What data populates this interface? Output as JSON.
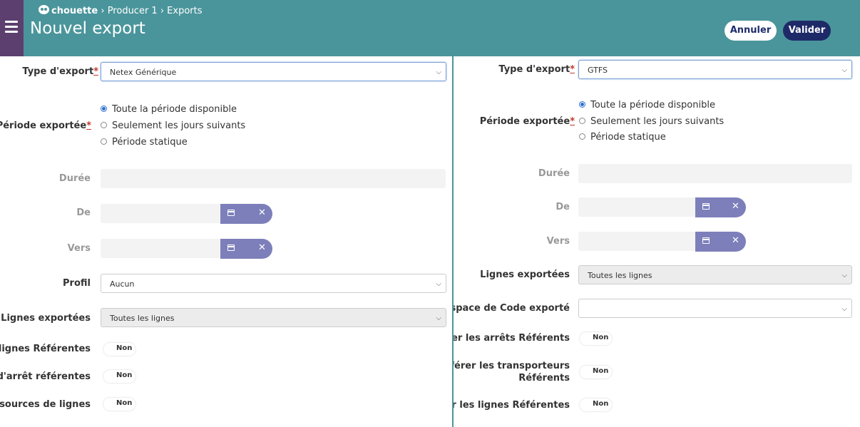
{
  "header": {
    "logo_text": "chouette",
    "breadcrumb_rest": "› Producer 1 › Exports",
    "title": "Nouvel export",
    "cancel_label": "Annuler",
    "submit_label": "Valider"
  },
  "left": {
    "type_label": "Type d'export",
    "type_value": "Netex Générique",
    "period_label": "Période exportée",
    "radio_all": "Toute la période disponible",
    "radio_following": "Seulement les jours suivants",
    "radio_static": "Période statique",
    "duration_label": "Durée",
    "from_label": "De",
    "to_label": "Vers",
    "profile_label": "Profil",
    "profile_value": "Aucun",
    "lines_label": "Lignes exportées",
    "lines_value": "Toutes les lignes",
    "toggle1_label": "es lignes Référentes",
    "toggle2_label": "s d'arrêt référentes",
    "toggle3_label": "essources de lignes",
    "toggle_value": "Non"
  },
  "right": {
    "type_label": "Type d'export",
    "type_value": "GTFS",
    "period_label": "Période exportée",
    "radio_all": "Toute la période disponible",
    "radio_following": "Seulement les jours suivants",
    "radio_static": "Période statique",
    "duration_label": "Durée",
    "from_label": "De",
    "to_label": "Vers",
    "lines_label": "Lignes exportées",
    "lines_value": "Toutes les lignes",
    "codespace_label": "Espace de Code exporté",
    "codespace_value": "",
    "toggle1_label": "férer les arrêts Référents",
    "toggle2_line1": "'référer les transporteurs",
    "toggle2_line2": "Référents",
    "toggle3_label": "érer les lignes Référentes",
    "toggle_value": "Non"
  },
  "required_mark": "*",
  "colors": {
    "header": "#4a959b",
    "menu": "#5c3f6e",
    "primary": "#1e2a68",
    "datepicker": "#7d7fbb"
  },
  "icons": [
    "menu-icon",
    "owl-logo-icon",
    "chevron-down-icon",
    "calendar-icon",
    "close-icon"
  ]
}
